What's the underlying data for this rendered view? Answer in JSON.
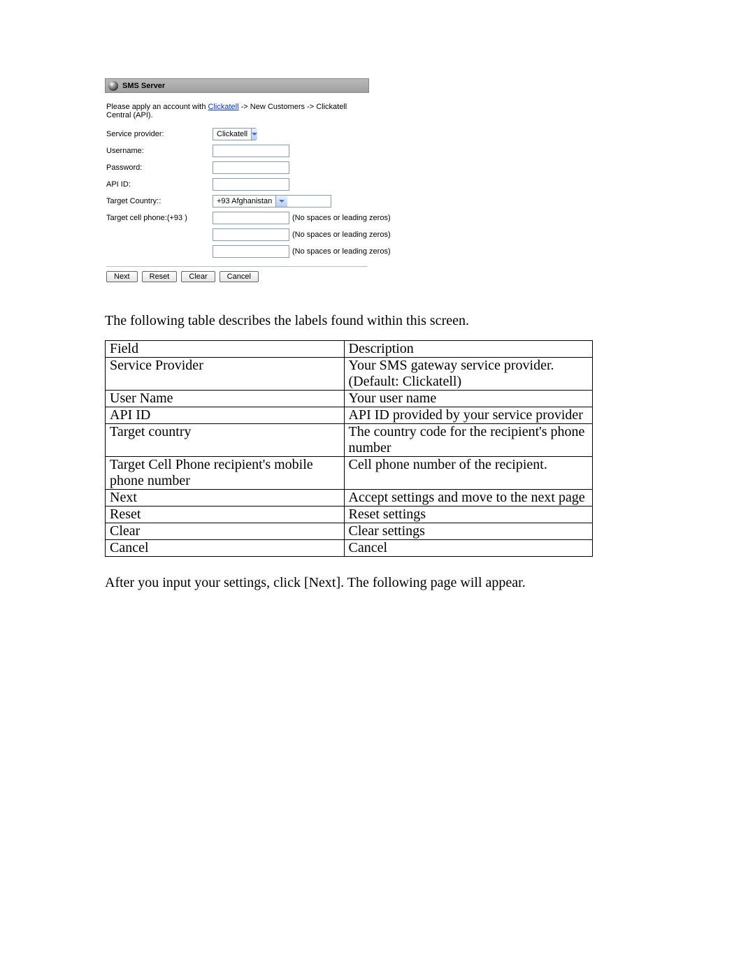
{
  "panel": {
    "title": "SMS Server",
    "apply_prefix": "Please apply an account with ",
    "apply_link": "Clickatell",
    "apply_suffix": " -> New Customers -> Clickatell Central (API).",
    "labels": {
      "service_provider": "Service provider:",
      "username": "Username:",
      "password": "Password:",
      "api_id": "API ID:",
      "target_country": "Target Country::",
      "target_cell": "Target cell phone:(+93 )"
    },
    "provider_value": "Clickatell",
    "country_value": "+93 Afghanistan",
    "phone_hint": "(No spaces or leading zeros)",
    "buttons": {
      "next": "Next",
      "reset": "Reset",
      "clear": "Clear",
      "cancel": "Cancel"
    }
  },
  "intro": "The following table describes the labels found within this screen.",
  "table": {
    "h1": "Field",
    "h2": "Description",
    "rows": [
      {
        "f": "Service Provider",
        "d": "Your SMS gateway service provider. (Default: Clickatell)"
      },
      {
        "f": "User Name",
        "d": "Your user name"
      },
      {
        "f": "API ID",
        "d": "API ID provided by your service provider"
      },
      {
        "f": "Target country",
        "d": "The country code for the recipient's phone number"
      },
      {
        "f": "Target Cell Phone recipient's mobile phone number",
        "d": "Cell phone number of the recipient."
      },
      {
        "f": "Next",
        "d": "Accept settings and move to the next page"
      },
      {
        "f": "Reset",
        "d": "Reset settings"
      },
      {
        "f": "Clear",
        "d": "Clear settings"
      },
      {
        "f": "Cancel",
        "d": "Cancel"
      }
    ]
  },
  "outro": "After you input your settings, click [Next]. The following page will appear."
}
